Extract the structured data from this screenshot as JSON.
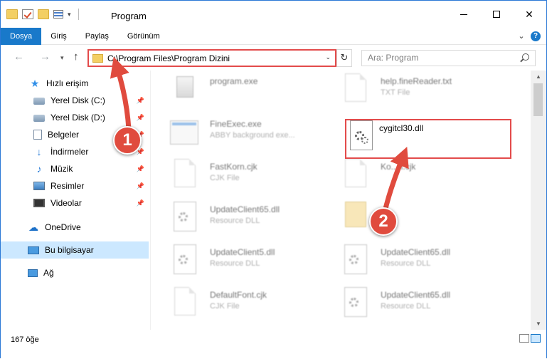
{
  "window": {
    "title": "Program",
    "minimize_icon": "minimize-icon",
    "maximize_icon": "maximize-icon",
    "close_icon": "close-icon",
    "close_glyph": "✕"
  },
  "ribbon": {
    "tabs": [
      {
        "label": "Dosya",
        "active": true
      },
      {
        "label": "Giriş"
      },
      {
        "label": "Paylaş"
      },
      {
        "label": "Görünüm"
      }
    ],
    "expand_glyph": "⌄",
    "help_glyph": "?"
  },
  "nav": {
    "back_glyph": "←",
    "forward_glyph": "→",
    "recent_glyph": "▾",
    "up_glyph": "↑",
    "address": "C:\\Program Files\\Program Dizini",
    "address_dropdown_glyph": "⌄",
    "refresh_glyph": "↻",
    "search_placeholder": "Ara: Program"
  },
  "sidebar": {
    "items": [
      {
        "label": "Hızlı erişim",
        "icon": "star-icon",
        "glyph": "★"
      },
      {
        "label": "Yerel Disk (C:)",
        "icon": "disk-icon",
        "pinned": true
      },
      {
        "label": "Yerel Disk (D:)",
        "icon": "disk-icon",
        "pinned": true
      },
      {
        "label": "Belgeler",
        "icon": "documents-icon",
        "pinned": true
      },
      {
        "label": "İndirmeler",
        "icon": "download-icon",
        "glyph": "↓",
        "pinned": true
      },
      {
        "label": "Müzik",
        "icon": "music-icon",
        "glyph": "♪",
        "pinned": true
      },
      {
        "label": "Resimler",
        "icon": "pictures-icon",
        "pinned": true
      },
      {
        "label": "Videolar",
        "icon": "video-icon",
        "pinned": true
      },
      {
        "label": "OneDrive",
        "icon": "cloud-icon",
        "glyph": "☁"
      },
      {
        "label": "Bu bilgisayar",
        "icon": "computer-icon",
        "selected": true
      },
      {
        "label": "Ağ",
        "icon": "network-icon"
      }
    ],
    "pin_glyph": "📌"
  },
  "files": [
    {
      "name": "program.exe",
      "type": "",
      "icon": "app-icon"
    },
    {
      "name": "help.fineReader.txt",
      "type": "TXT File",
      "icon": "document-icon"
    },
    {
      "name": "FineExec.exe",
      "type": "ABBY background exe...",
      "icon": "exe-icon"
    },
    {
      "name": "cygitcl30.dll",
      "type": "",
      "icon": "dll-gear-icon",
      "highlighted": true
    },
    {
      "name": "FastKorn.cjk",
      "type": "CJK File",
      "icon": "document-icon"
    },
    {
      "name": "Ko...n.cjk",
      "type": "",
      "icon": "document-icon"
    },
    {
      "name": "UpdateClient65.dll",
      "type": "Resource DLL",
      "icon": "dll-gear-icon"
    },
    {
      "name": "",
      "type": "",
      "icon": "zip-icon"
    },
    {
      "name": "UpdateClient5.dll",
      "type": "Resource DLL",
      "icon": "dll-gear-icon"
    },
    {
      "name": "UpdateClient65.dll",
      "type": "Resource DLL",
      "icon": "dll-gear-icon"
    },
    {
      "name": "DefaultFont.cjk",
      "type": "CJK File",
      "icon": "document-icon"
    },
    {
      "name": "UpdateClient65.dll",
      "type": "Resource DLL",
      "icon": "dll-gear-icon"
    }
  ],
  "annotations": {
    "step1": "1",
    "step2": "2",
    "accent_color": "#e04b3e"
  },
  "scrollbar": {
    "up_glyph": "▲",
    "down_glyph": "▼"
  },
  "status": {
    "item_count": "167 öğe"
  },
  "colors": {
    "ribbon_active": "#1979ca",
    "selection": "#cce8ff",
    "highlight_border": "#e34b4b"
  }
}
